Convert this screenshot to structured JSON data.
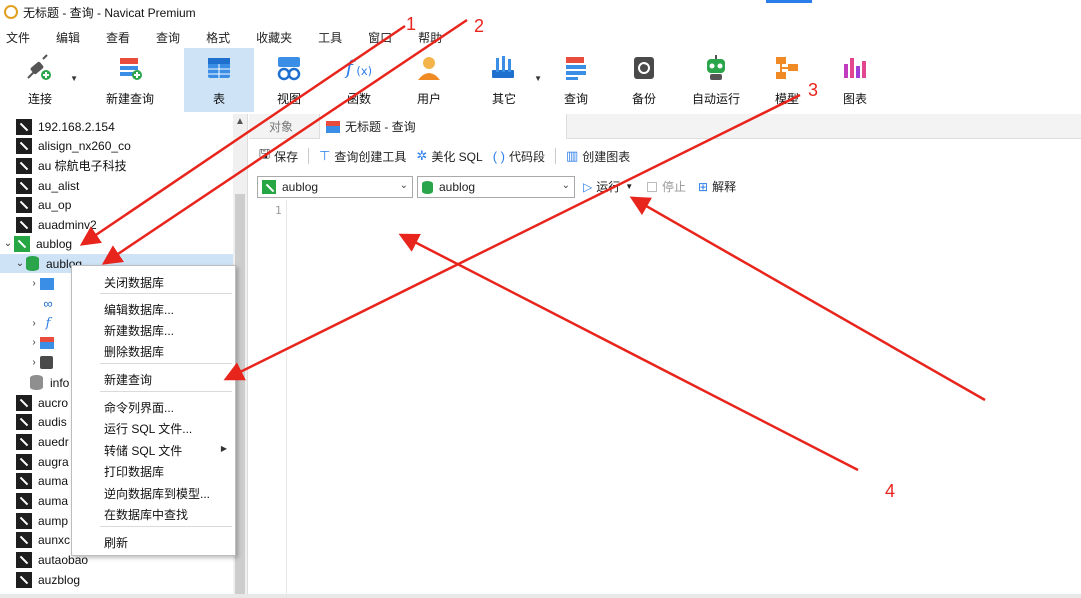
{
  "window": {
    "title": "无标题 - 查询 - Navicat Premium"
  },
  "menu": [
    "文件",
    "编辑",
    "查看",
    "查询",
    "格式",
    "收藏夹",
    "工具",
    "窗口",
    "帮助"
  ],
  "toolbar": {
    "items": [
      {
        "id": "connect",
        "label": "连接",
        "icon": "plug-icon"
      },
      {
        "id": "new-query",
        "label": "新建查询",
        "icon": "new-query-icon"
      },
      {
        "id": "table",
        "label": "表",
        "icon": "table-icon"
      },
      {
        "id": "view",
        "label": "视图",
        "icon": "view-icon"
      },
      {
        "id": "function",
        "label": "函数",
        "icon": "function-icon"
      },
      {
        "id": "user",
        "label": "用户",
        "icon": "user-icon"
      },
      {
        "id": "other",
        "label": "其它",
        "icon": "tools-icon"
      },
      {
        "id": "query",
        "label": "查询",
        "icon": "query-icon"
      },
      {
        "id": "backup",
        "label": "备份",
        "icon": "backup-icon"
      },
      {
        "id": "automation",
        "label": "自动运行",
        "icon": "robot-icon"
      },
      {
        "id": "model",
        "label": "模型",
        "icon": "model-icon"
      },
      {
        "id": "chart",
        "label": "图表",
        "icon": "chart-icon"
      }
    ]
  },
  "sidebar": {
    "top_items": [
      "192.168.2.154",
      "alisign_nx260_co",
      "au 棕航电子科技",
      "au_alist",
      "au_op",
      "auadminv2"
    ],
    "open_connection": "aublog",
    "open_database": "aublog",
    "child_info": "info",
    "bottom_items": [
      "aucro",
      "audis",
      "auedr",
      "augra",
      "auma",
      "auma",
      "aump",
      "aunxc",
      "autaobao",
      "auzblog"
    ]
  },
  "context_menu": {
    "groups": [
      [
        "关闭数据库"
      ],
      [
        "编辑数据库...",
        "新建数据库...",
        "删除数据库"
      ],
      [
        "新建查询"
      ],
      [
        "命令列界面...",
        "运行 SQL 文件...",
        "转储 SQL 文件",
        "打印数据库",
        "逆向数据库到模型...",
        "在数据库中查找"
      ],
      [
        "刷新"
      ]
    ]
  },
  "tabs": {
    "objects": "对象",
    "query_tab": "无标题 - 查询"
  },
  "query_toolbar": {
    "save": "保存",
    "builder": "查询创建工具",
    "beautify": "美化 SQL",
    "snippet": "代码段",
    "create_chart": "创建图表"
  },
  "query_row": {
    "connection_value": "aublog",
    "database_value": "aublog",
    "run": "运行",
    "stop": "停止",
    "explain": "解释"
  },
  "editor": {
    "line_number": "1"
  },
  "annotations": [
    "1",
    "2",
    "3",
    "4"
  ],
  "colors": {
    "annotation": "#e8251c",
    "selected": "#cfe3f7",
    "db_green": "#2aa54b"
  }
}
